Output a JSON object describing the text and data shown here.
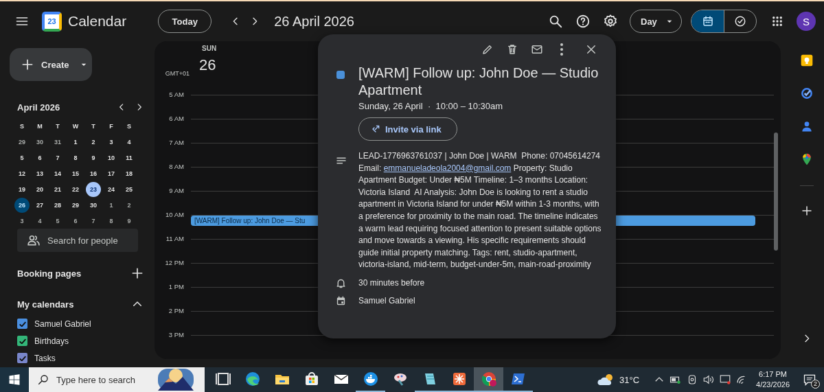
{
  "header": {
    "app_name": "Calendar",
    "logo_text": "23",
    "today_button": "Today",
    "period": "26 April 2026",
    "view_selector": "Day",
    "avatar": "S",
    "view_toggle": [
      {
        "kind": "calendar",
        "selected": true
      },
      {
        "kind": "tasks",
        "selected": false
      }
    ]
  },
  "create_button": "Create",
  "mini_calendar": {
    "month": "April 2026",
    "weekdays": [
      "S",
      "M",
      "T",
      "W",
      "T",
      "F",
      "S"
    ],
    "weeks": [
      [
        {
          "label": "29",
          "in_month": false,
          "today": false,
          "selected": false
        },
        {
          "label": "30",
          "in_month": false,
          "today": false,
          "selected": false
        },
        {
          "label": "31",
          "in_month": false,
          "today": false,
          "selected": false
        },
        {
          "label": "1",
          "in_month": true,
          "today": false,
          "selected": false
        },
        {
          "label": "2",
          "in_month": true,
          "today": false,
          "selected": false
        },
        {
          "label": "3",
          "in_month": true,
          "today": false,
          "selected": false
        },
        {
          "label": "4",
          "in_month": true,
          "today": false,
          "selected": false
        }
      ],
      [
        {
          "label": "5",
          "in_month": true,
          "today": false,
          "selected": false
        },
        {
          "label": "6",
          "in_month": true,
          "today": false,
          "selected": false
        },
        {
          "label": "7",
          "in_month": true,
          "today": false,
          "selected": false
        },
        {
          "label": "8",
          "in_month": true,
          "today": false,
          "selected": false
        },
        {
          "label": "9",
          "in_month": true,
          "today": false,
          "selected": false
        },
        {
          "label": "10",
          "in_month": true,
          "today": false,
          "selected": false
        },
        {
          "label": "11",
          "in_month": true,
          "today": false,
          "selected": false
        }
      ],
      [
        {
          "label": "12",
          "in_month": true,
          "today": false,
          "selected": false
        },
        {
          "label": "13",
          "in_month": true,
          "today": false,
          "selected": false
        },
        {
          "label": "14",
          "in_month": true,
          "today": false,
          "selected": false
        },
        {
          "label": "15",
          "in_month": true,
          "today": false,
          "selected": false
        },
        {
          "label": "16",
          "in_month": true,
          "today": false,
          "selected": false
        },
        {
          "label": "17",
          "in_month": true,
          "today": false,
          "selected": false
        },
        {
          "label": "18",
          "in_month": true,
          "today": false,
          "selected": false
        }
      ],
      [
        {
          "label": "19",
          "in_month": true,
          "today": false,
          "selected": false
        },
        {
          "label": "20",
          "in_month": true,
          "today": false,
          "selected": false
        },
        {
          "label": "21",
          "in_month": true,
          "today": false,
          "selected": false
        },
        {
          "label": "22",
          "in_month": true,
          "today": false,
          "selected": false
        },
        {
          "label": "23",
          "in_month": true,
          "today": true,
          "selected": false
        },
        {
          "label": "24",
          "in_month": true,
          "today": false,
          "selected": false
        },
        {
          "label": "25",
          "in_month": true,
          "today": false,
          "selected": false
        }
      ],
      [
        {
          "label": "26",
          "in_month": true,
          "today": false,
          "selected": true
        },
        {
          "label": "27",
          "in_month": true,
          "today": false,
          "selected": false
        },
        {
          "label": "28",
          "in_month": true,
          "today": false,
          "selected": false
        },
        {
          "label": "29",
          "in_month": true,
          "today": false,
          "selected": false
        },
        {
          "label": "30",
          "in_month": true,
          "today": false,
          "selected": false
        },
        {
          "label": "1",
          "in_month": false,
          "today": false,
          "selected": false
        },
        {
          "label": "2",
          "in_month": false,
          "today": false,
          "selected": false
        }
      ],
      [
        {
          "label": "3",
          "in_month": false,
          "today": false,
          "selected": false
        },
        {
          "label": "4",
          "in_month": false,
          "today": false,
          "selected": false
        },
        {
          "label": "5",
          "in_month": false,
          "today": false,
          "selected": false
        },
        {
          "label": "6",
          "in_month": false,
          "today": false,
          "selected": false
        },
        {
          "label": "7",
          "in_month": false,
          "today": false,
          "selected": false
        },
        {
          "label": "8",
          "in_month": false,
          "today": false,
          "selected": false
        },
        {
          "label": "9",
          "in_month": false,
          "today": false,
          "selected": false
        }
      ]
    ]
  },
  "people_search": {
    "placeholder": "Search for people"
  },
  "booking_pages": "Booking pages",
  "my_calendars": {
    "title": "My calendars",
    "expanded": true,
    "items": [
      {
        "name": "Samuel Gabriel",
        "checked": true,
        "color": "#4a8fe0"
      },
      {
        "name": "Birthdays",
        "checked": true,
        "color": "#33b679"
      },
      {
        "name": "Tasks",
        "checked": true,
        "color": "#7986cb"
      }
    ]
  },
  "day_view": {
    "weekday": "SUN",
    "date": "26",
    "timezone": "GMT+01",
    "hours": [
      {
        "label": "5 AM"
      },
      {
        "label": "6 AM"
      },
      {
        "label": "7 AM"
      },
      {
        "label": "8 AM"
      },
      {
        "label": "9 AM"
      },
      {
        "label": "10 AM",
        "events": [
          {
            "title": "[WARM] Follow up: John Doe — Stu"
          }
        ]
      },
      {
        "label": "11 AM"
      },
      {
        "label": "12 PM"
      },
      {
        "label": "1 PM"
      },
      {
        "label": "2 PM"
      },
      {
        "label": "3 PM"
      }
    ]
  },
  "event_popup": {
    "title": "[WARM] Follow up: John Doe — Studio Apartment",
    "when": "Sunday, 26 April  ·  10:00 – 10:30am",
    "invite_button": "Invite via link",
    "description": {
      "before": "LEAD-1776963761037 | John Doe | WARM  Phone: 07045614274 Email: ",
      "link": "emmanueladeola2004@gmail.com",
      "after": " Property: Studio Apartment Budget: Under ₦5M Timeline: 1–3 months Location: Victoria Island  AI Analysis: John Doe is looking to rent a studio apartment in Victoria Island for under ₦5M within 1-3 months, with a preference for proximity to the main road. The timeline indicates a warm lead requiring focused attention to present suitable options and move towards a viewing. His specific requirements should guide initial property matching. Tags: rent, studio-apartment, victoria-island, mid-term, budget-under-5m, main-road-proximity"
    },
    "reminder": "30 minutes before",
    "calendar": "Samuel Gabriel"
  },
  "taskbar": {
    "search_placeholder": "Type here to search",
    "apps": [
      {
        "kind": "taskview",
        "running": false,
        "active": false
      },
      {
        "kind": "edge",
        "running": false,
        "active": false
      },
      {
        "kind": "explorer",
        "running": false,
        "active": false
      },
      {
        "kind": "store",
        "running": false,
        "active": false
      },
      {
        "kind": "mail",
        "running": false,
        "active": false
      },
      {
        "kind": "docker",
        "running": true,
        "active": false
      },
      {
        "kind": "paint",
        "running": false,
        "active": false
      },
      {
        "kind": "notepad",
        "running": true,
        "active": false
      },
      {
        "kind": "burst",
        "running": true,
        "active": false
      },
      {
        "kind": "chrome",
        "running": true,
        "active": true
      },
      {
        "kind": "terminal",
        "running": true,
        "active": false
      }
    ],
    "weather": "31°C",
    "time": "6:17 PM",
    "date": "4/23/2026",
    "notifications": "2"
  }
}
